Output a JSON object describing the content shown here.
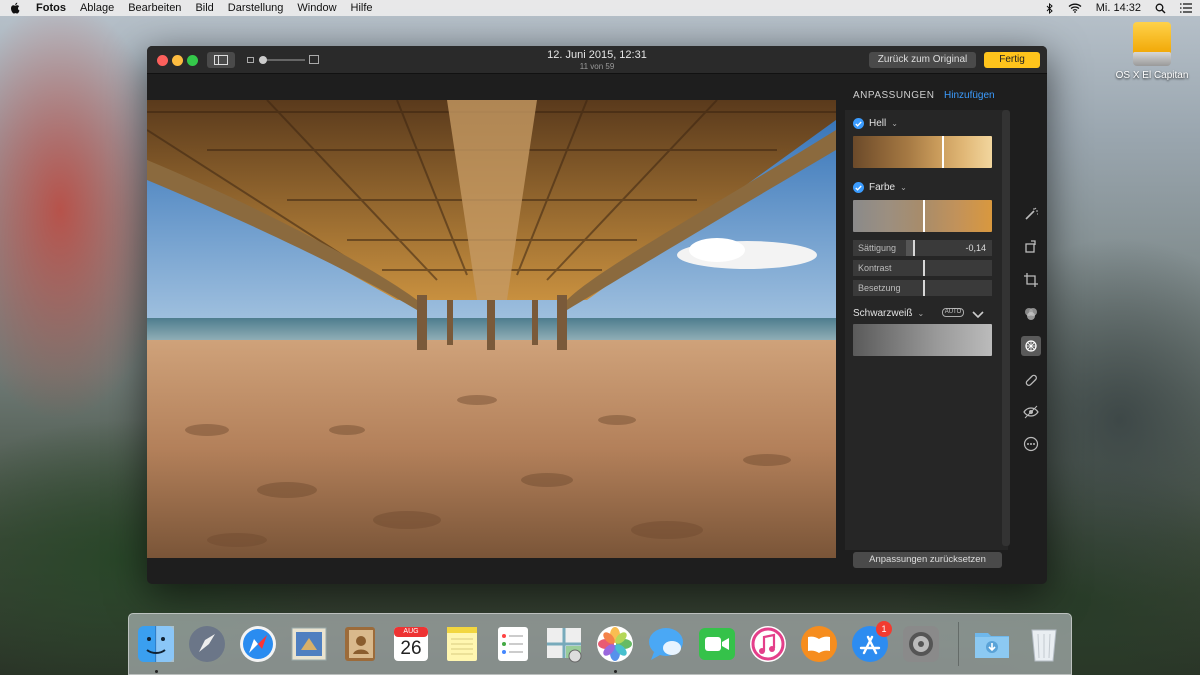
{
  "menubar": {
    "app_name": "Fotos",
    "items": [
      "Ablage",
      "Bearbeiten",
      "Bild",
      "Darstellung",
      "Window",
      "Hilfe"
    ],
    "clock": "Mi. 14:32"
  },
  "desktop": {
    "drive_label": "OS X El Capitan"
  },
  "window": {
    "title": "12. Juni 2015, 12:31",
    "subtitle": "11 von 59",
    "revert_label": "Zurück zum Original",
    "done_label": "Fertig",
    "zoom_level": 0
  },
  "panel": {
    "tab_adjust": "ANPASSUNGEN",
    "tab_add": "Hinzufügen",
    "light": {
      "label": "Hell",
      "marker": 0.64
    },
    "color": {
      "label": "Farbe",
      "marker": 0.5,
      "rows": [
        {
          "label": "Sättigung",
          "value": "-0,14",
          "level": 0.43
        },
        {
          "label": "Kontrast",
          "value": "",
          "level": 0.5
        },
        {
          "label": "Besetzung",
          "value": "",
          "level": 0.5
        }
      ]
    },
    "bw": {
      "label": "Schwarzweiß",
      "auto_label": "AUTO"
    },
    "reset_label": "Anpassungen zurücksetzen"
  },
  "dock": {
    "appstore_badge": "1",
    "calendar_month": "AUG",
    "calendar_day": "26"
  },
  "colors": {
    "accent_blue": "#3b9cff",
    "done_yellow": "#ffc41c",
    "window_bg": "#1e1e1e"
  }
}
